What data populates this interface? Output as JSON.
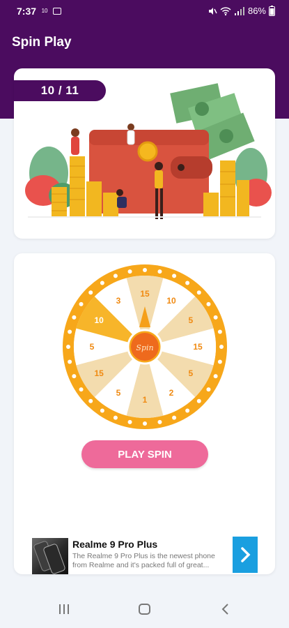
{
  "status_bar": {
    "time": "7:37",
    "mini_label": "10",
    "battery": "86%"
  },
  "header": {
    "title": "Spin Play"
  },
  "progress": {
    "label": "10 / 11"
  },
  "wheel": {
    "center_label": "Spin",
    "segments": [
      "15",
      "10",
      "5",
      "15",
      "5",
      "2",
      "1",
      "5",
      "15",
      "5",
      "10",
      "3"
    ]
  },
  "play_button": {
    "label": "PLAY SPIN"
  },
  "ad": {
    "title": "Realme 9 Pro Plus",
    "description": "The Realme 9 Pro Plus is the newest phone from Realme and it's packed full of great..."
  },
  "colors": {
    "header_bg": "#4b0c5f",
    "button": "#ee6a9a",
    "wheel_orange": "#f7a71a",
    "ad_arrow": "#1a9fe0"
  }
}
